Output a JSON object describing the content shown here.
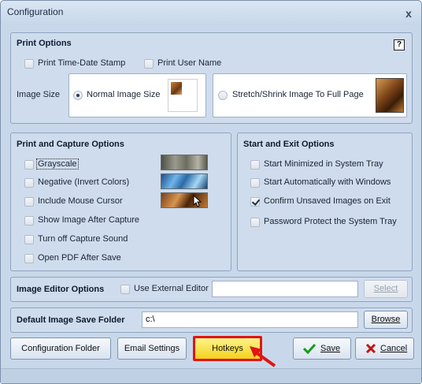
{
  "window": {
    "title": "Configuration",
    "close_glyph": "x"
  },
  "print_options": {
    "title": "Print Options",
    "help_glyph": "?",
    "print_time_date_stamp": {
      "label": "Print Time-Date Stamp",
      "checked": false
    },
    "print_user_name": {
      "label": "Print User Name",
      "checked": false
    },
    "image_size_label": "Image Size",
    "normal_image_size": {
      "label": "Normal Image Size",
      "selected": true
    },
    "stretch_shrink": {
      "label": "Stretch/Shrink Image To Full Page",
      "selected": false
    }
  },
  "print_capture_options": {
    "title": "Print and Capture Options",
    "items": [
      {
        "label": "Grayscale",
        "checked": false
      },
      {
        "label": "Negative (Invert Colors)",
        "checked": false
      },
      {
        "label": "Include Mouse Cursor",
        "checked": false
      },
      {
        "label": "Show Image After Capture",
        "checked": false
      },
      {
        "label": "Turn off Capture Sound",
        "checked": false
      },
      {
        "label": "Open PDF After Save",
        "checked": false
      }
    ]
  },
  "start_exit_options": {
    "title": "Start and Exit Options",
    "items": [
      {
        "label": "Start Minimized  in System Tray",
        "checked": false
      },
      {
        "label": "Start Automatically with Windows",
        "checked": false
      },
      {
        "label": "Confirm Unsaved Images on Exit",
        "checked": true
      },
      {
        "label": "Password Protect the System Tray",
        "checked": false
      }
    ]
  },
  "image_editor_options": {
    "title": "Image Editor Options",
    "use_external_editor": {
      "label": "Use External Editor",
      "checked": false
    },
    "editor_path_value": "",
    "select_label": "Select"
  },
  "default_save_folder": {
    "title": "Default Image Save Folder",
    "value": "c:\\",
    "browse_label": "Browse"
  },
  "buttons": {
    "configuration_folder": "Configuration Folder",
    "email_settings": "Email Settings",
    "hotkeys": "Hotkeys",
    "save": "Save",
    "cancel": "Cancel"
  },
  "icons": {
    "save": "check-icon",
    "cancel": "x-icon",
    "annotation": "red-arrow-icon"
  },
  "colors": {
    "window_bg": "#c8d8ea",
    "hotkeys_highlight": "#f2d21e",
    "annotation_red": "#e01515",
    "save_check": "#1a9a1a",
    "cancel_x": "#c81010"
  }
}
